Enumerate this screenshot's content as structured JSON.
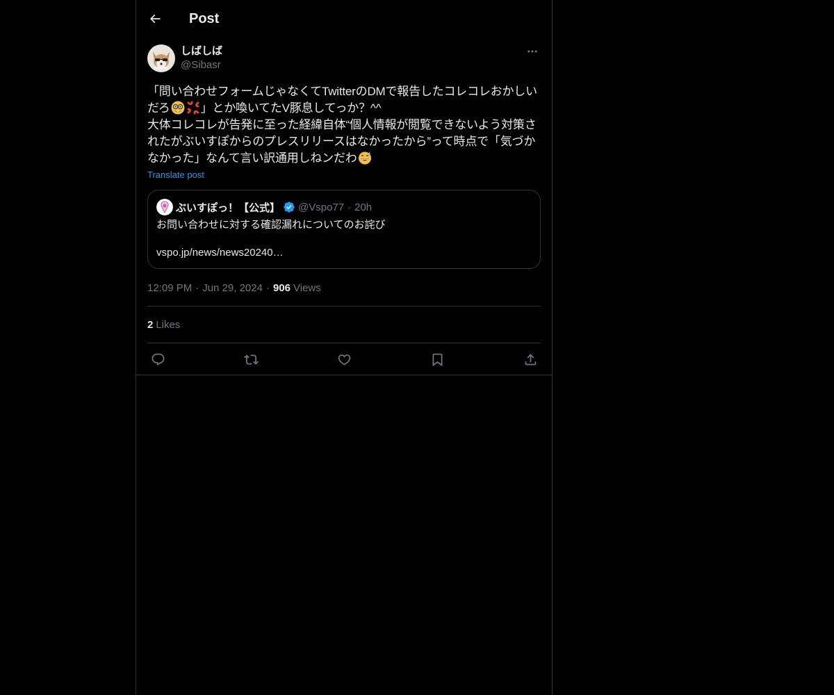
{
  "header": {
    "title": "Post"
  },
  "post": {
    "display_name": "しばしば",
    "handle": "@Sibasr",
    "text_part1": "「問い合わせフォームじゃなくてTwitterのDMで報告したコレコレおかしいだろ",
    "text_part2": "」とか喚いてたV豚息してっか？^^\n大体コレコレが告発に至った経緯自体“個人情報が閲覧できないよう対策されたがぶいすぽからのプレスリリースはなかったから”って時点で「気づかなかった」なんて言い訳通用しねンだわ",
    "translate_label": "Translate post",
    "time": "12:09 PM",
    "date": "Jun 29, 2024",
    "views_count": "906",
    "views_label": "Views",
    "likes_count": "2",
    "likes_label": "Likes"
  },
  "quote": {
    "display_name": "ぶいすぽっ！【公式】",
    "handle": "@Vspo77",
    "time": "20h",
    "body": "お問い合わせに対する確認漏れについてのお詫び",
    "link": "vspo.jp/news/news20240…"
  },
  "separators": {
    "dot": "·"
  },
  "icons": {
    "back": "back-arrow-icon",
    "more": "more-dots-icon",
    "reply": "reply-icon",
    "repost": "repost-icon",
    "like": "heart-icon",
    "bookmark": "bookmark-icon",
    "share": "share-icon",
    "verified": "verified-badge-icon"
  },
  "colors": {
    "background": "#000000",
    "text": "#e7e9ea",
    "secondary": "#71767b",
    "accent": "#1d9bf0",
    "border": "#2f3336"
  }
}
